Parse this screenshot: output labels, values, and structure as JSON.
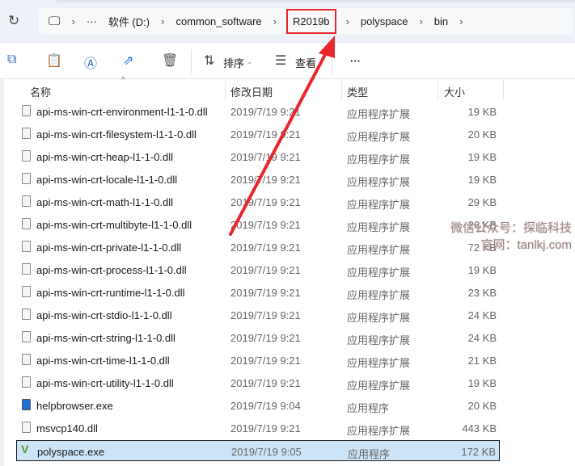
{
  "breadcrumb": {
    "items": [
      "软件 (D:)",
      "common_software",
      "R2019b",
      "polyspace",
      "bin"
    ],
    "more": "···"
  },
  "toolbar": {
    "sort": "排序",
    "view": "查看",
    "more": "···"
  },
  "columns": {
    "name": "名称",
    "date": "修改日期",
    "type": "类型",
    "size": "大小"
  },
  "files": [
    {
      "name": "api-ms-win-crt-environment-l1-1-0.dll",
      "date": "2019/7/19 9:21",
      "type": "应用程序扩展",
      "size": "19 KB",
      "icon": "dll"
    },
    {
      "name": "api-ms-win-crt-filesystem-l1-1-0.dll",
      "date": "2019/7/19 9:21",
      "type": "应用程序扩展",
      "size": "20 KB",
      "icon": "dll"
    },
    {
      "name": "api-ms-win-crt-heap-l1-1-0.dll",
      "date": "2019/7/19 9:21",
      "type": "应用程序扩展",
      "size": "19 KB",
      "icon": "dll"
    },
    {
      "name": "api-ms-win-crt-locale-l1-1-0.dll",
      "date": "2019/7/19 9:21",
      "type": "应用程序扩展",
      "size": "19 KB",
      "icon": "dll"
    },
    {
      "name": "api-ms-win-crt-math-l1-1-0.dll",
      "date": "2019/7/19 9:21",
      "type": "应用程序扩展",
      "size": "29 KB",
      "icon": "dll"
    },
    {
      "name": "api-ms-win-crt-multibyte-l1-1-0.dll",
      "date": "2019/7/19 9:21",
      "type": "应用程序扩展",
      "size": "26 KB",
      "icon": "dll"
    },
    {
      "name": "api-ms-win-crt-private-l1-1-0.dll",
      "date": "2019/7/19 9:21",
      "type": "应用程序扩展",
      "size": "72 KB",
      "icon": "dll"
    },
    {
      "name": "api-ms-win-crt-process-l1-1-0.dll",
      "date": "2019/7/19 9:21",
      "type": "应用程序扩展",
      "size": "19 KB",
      "icon": "dll"
    },
    {
      "name": "api-ms-win-crt-runtime-l1-1-0.dll",
      "date": "2019/7/19 9:21",
      "type": "应用程序扩展",
      "size": "23 KB",
      "icon": "dll"
    },
    {
      "name": "api-ms-win-crt-stdio-l1-1-0.dll",
      "date": "2019/7/19 9:21",
      "type": "应用程序扩展",
      "size": "24 KB",
      "icon": "dll"
    },
    {
      "name": "api-ms-win-crt-string-l1-1-0.dll",
      "date": "2019/7/19 9:21",
      "type": "应用程序扩展",
      "size": "24 KB",
      "icon": "dll"
    },
    {
      "name": "api-ms-win-crt-time-l1-1-0.dll",
      "date": "2019/7/19 9:21",
      "type": "应用程序扩展",
      "size": "21 KB",
      "icon": "dll"
    },
    {
      "name": "api-ms-win-crt-utility-l1-1-0.dll",
      "date": "2019/7/19 9:21",
      "type": "应用程序扩展",
      "size": "19 KB",
      "icon": "dll"
    },
    {
      "name": "helpbrowser.exe",
      "date": "2019/7/19 9:04",
      "type": "应用程序",
      "size": "20 KB",
      "icon": "exe"
    },
    {
      "name": "msvcp140.dll",
      "date": "2019/7/19 9:21",
      "type": "应用程序扩展",
      "size": "443 KB",
      "icon": "dll"
    },
    {
      "name": "polyspace.exe",
      "date": "2019/7/19 9:05",
      "type": "应用程序",
      "size": "172 KB",
      "icon": "v",
      "selected": true
    }
  ],
  "watermark": {
    "line1": "微信公众号：探临科技",
    "line2": "官网：tanlkj.com"
  },
  "colors": {
    "highlight": "#e8262c",
    "selection": "#cce4f7"
  }
}
